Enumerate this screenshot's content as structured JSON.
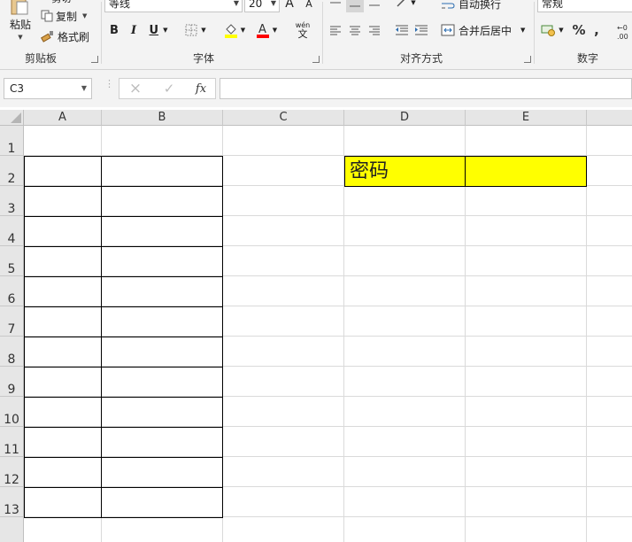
{
  "ribbon": {
    "clipboard": {
      "paste_label": "粘贴",
      "cut_label": "剪切",
      "copy_label": "复制",
      "format_painter_label": "格式刷",
      "group_label": "剪贴板"
    },
    "font": {
      "font_name": "等线",
      "font_size": "20",
      "bold": "B",
      "italic": "I",
      "underline": "U",
      "grow": "A",
      "shrink": "A",
      "wen_label": "wén",
      "wen_char": "文",
      "group_label": "字体",
      "fill_color": "#ffff00",
      "font_color": "#ff0000"
    },
    "alignment": {
      "wrap_text_label": "自动换行",
      "merge_center_label": "合并后居中",
      "group_label": "对齐方式"
    },
    "number": {
      "format": "常规",
      "percent": "%",
      "comma": ",",
      "group_label": "数字"
    }
  },
  "formula_bar": {
    "name_box": "C3",
    "fx_label": "fx",
    "cancel_icon": "×",
    "enter_icon": "✓",
    "formula": ""
  },
  "sheet": {
    "columns": [
      "A",
      "B",
      "C",
      "D",
      "E"
    ],
    "rows": [
      "1",
      "2",
      "3",
      "4",
      "5",
      "6",
      "7",
      "8",
      "9",
      "10",
      "11",
      "12",
      "13"
    ],
    "cells": {
      "D2": "密码",
      "D2_fill": "#ffff00",
      "E2_fill": "#ffff00"
    }
  }
}
